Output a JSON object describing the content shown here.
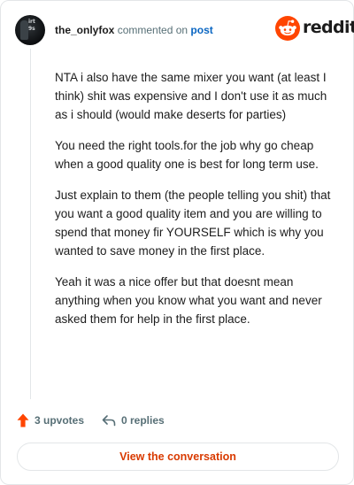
{
  "comment": {
    "author": "the_onlyfox",
    "action_text": "commented on",
    "link_text": "post",
    "avatar_text": "irt\n9s",
    "paragraphs": [
      "NTA i also have the same mixer you want (at least I think) shit was expensive and I don't use it as much as i should (would make deserts for parties)",
      "You need the right tools.for the job why go cheap when a good quality one is best for long term use.",
      "Just explain to them (the people telling you shit) that you want a good quality item and you are willing to spend that money fir YOURSELF which is why you wanted to save money in the first place.",
      "Yeah it was a nice offer but that doesnt mean anything when you know what you want and never asked them for help in the first place."
    ]
  },
  "brand": {
    "name": "reddit",
    "icon": "reddit-snoo-icon",
    "color": "#ff4500"
  },
  "footer": {
    "upvotes_label": "3 upvotes",
    "replies_label": "0 replies",
    "upvote_icon": "upvote-arrow-icon",
    "reply_icon": "reply-arrow-icon",
    "upvote_color": "#ff4500"
  },
  "cta": {
    "label": "View the conversation",
    "color": "#d93a00"
  }
}
